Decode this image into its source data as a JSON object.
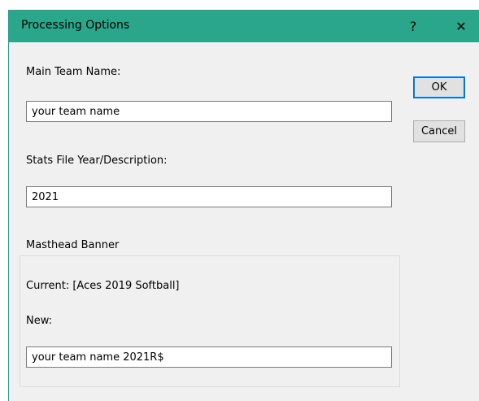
{
  "window": {
    "title": "Processing Options",
    "help_glyph": "?",
    "close_glyph": "✕"
  },
  "team": {
    "label": "Main Team Name:",
    "value": "your team name"
  },
  "stats": {
    "label": "Stats File Year/Description:",
    "value": "2021"
  },
  "masthead": {
    "group_label": "Masthead Banner",
    "current_text": "Current: [Aces 2019 Softball]",
    "new_label": "New:",
    "new_value": "your team name 2021R$"
  },
  "buttons": {
    "ok": "OK",
    "cancel": "Cancel"
  },
  "colors": {
    "titlebar": "#2aa68a",
    "dialog_bg": "#f0f0f0",
    "focus_border": "#0078d7"
  }
}
